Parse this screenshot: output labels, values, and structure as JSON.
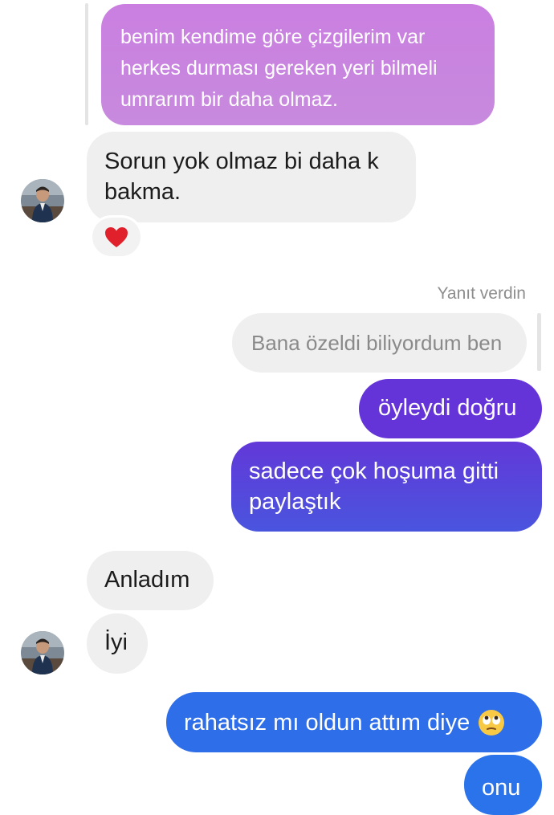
{
  "messages": {
    "quoted_received": "benim kendime göre çizgilerim var herkes durması gereken yeri bilmeli umrarım bir daha olmaz.",
    "sorun": "Sorun yok olmaz bi daha k bakma.",
    "reaction_emoji": "heart-emoji",
    "replied_label": "Yanıt verdin",
    "quoted_sent": "Bana özeldi biliyordum ben",
    "oyleydi": "öyleydi doğru",
    "sadece": "sadece çok hoşuma gitti paylaştık",
    "anladim": "Anladım",
    "iyi": "İyi",
    "rahatsiz": "rahatsız mı oldun attım diye",
    "rahatsiz_emoji": "eye-roll-emoji",
    "onu": "onu"
  },
  "colors": {
    "quoted_purple": "#c985df",
    "received_gray": "#efefef",
    "sent_purple": "#6434d8",
    "sent_indigo": "#5147dc",
    "sent_blue": "#2e6ee8",
    "heart": "#e0202a"
  }
}
